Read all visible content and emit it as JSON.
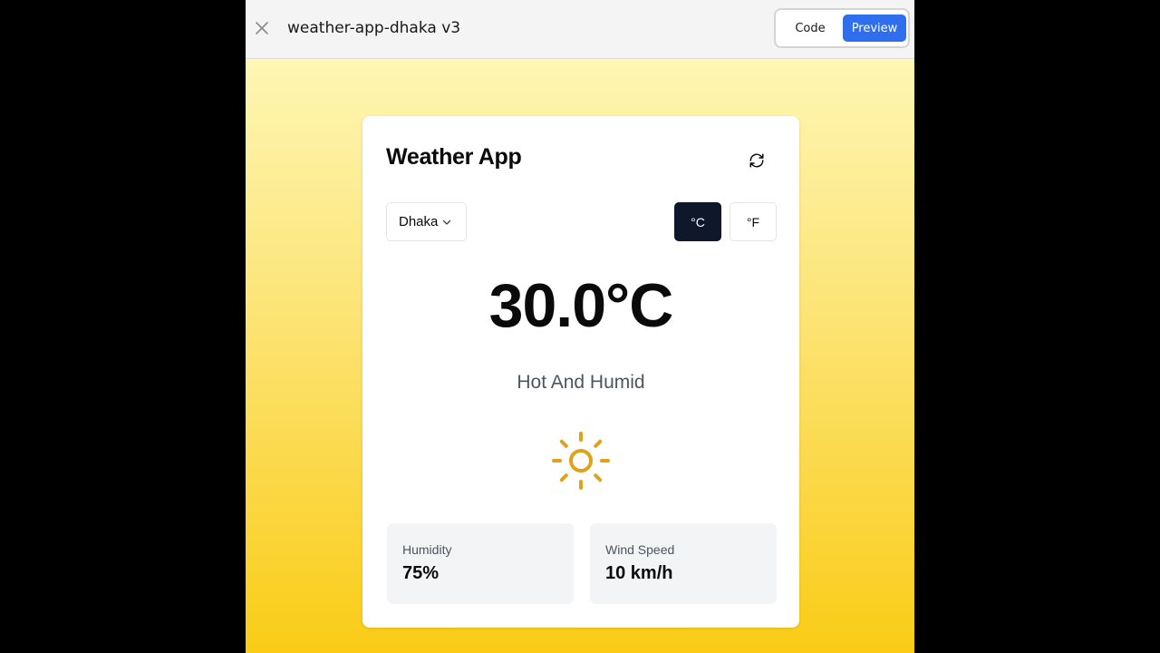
{
  "topbar": {
    "close_icon": "close-icon",
    "project_title": "weather-app-dhaka v3",
    "view_toggle": {
      "code_label": "Code",
      "preview_label": "Preview",
      "active": "Preview",
      "active_color": "#2f6fed"
    }
  },
  "app": {
    "title": "Weather App",
    "refresh_icon": "refresh-icon",
    "city_select": {
      "selected": "Dhaka",
      "icon": "chevron-down-icon"
    },
    "units": {
      "celsius_label": "°C",
      "fahrenheit_label": "°F",
      "active": "°C"
    },
    "temperature": "30.0°C",
    "condition": "Hot And Humid",
    "weather_icon": "sun-icon",
    "stats": {
      "humidity": {
        "label": "Humidity",
        "value": "75%"
      },
      "wind_speed": {
        "label": "Wind Speed",
        "value": "10 km/h"
      }
    }
  },
  "colors": {
    "background_gradient_top": "#fef6b4",
    "background_gradient_bottom": "#facc15",
    "active_unit_bg": "#0f172a",
    "sun_color": "#e0a21a"
  }
}
